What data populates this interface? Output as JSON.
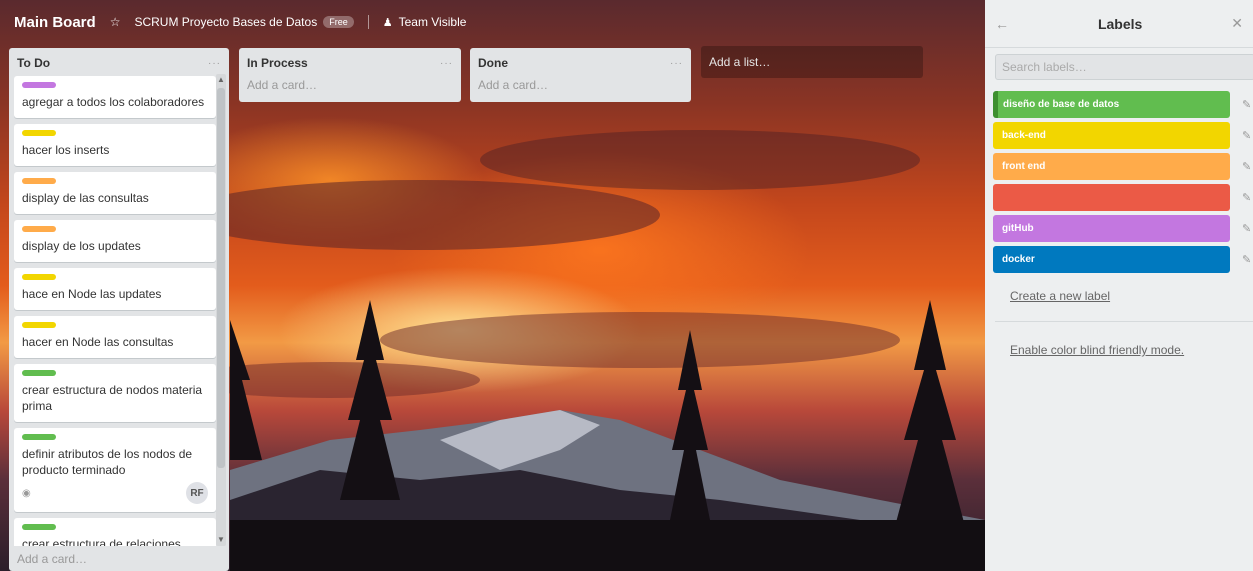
{
  "board": {
    "title": "Main Board",
    "star_icon": "star-icon",
    "project": "SCRUM Proyecto Bases de Datos",
    "plan_badge": "Free",
    "visibility": "Team Visible",
    "visibility_icon": "team-icon"
  },
  "lists": {
    "todo": {
      "title": "To Do",
      "add_card": "Add a card…",
      "cards": [
        {
          "title": "agregar a todos los colaboradores",
          "label_color": "#c377e0"
        },
        {
          "title": "hacer los inserts",
          "label_color": "#f2d600"
        },
        {
          "title": "display de las consultas",
          "label_color": "#ffab4a"
        },
        {
          "title": "display de los updates",
          "label_color": "#ffab4a"
        },
        {
          "title": "hace en Node las updates",
          "label_color": "#f2d600"
        },
        {
          "title": "hacer en Node las consultas",
          "label_color": "#f2d600"
        },
        {
          "title": "crear estructura de nodos materia prima",
          "label_color": "#61bd4f"
        },
        {
          "title": "definir atributos de los nodos de producto terminado",
          "label_color": "#61bd4f",
          "watch_icon": "eye-icon",
          "member": "RF"
        },
        {
          "title": "crear estructura de relaciones receta-materia-prima",
          "label_color": "#61bd4f"
        }
      ]
    },
    "inprocess": {
      "title": "In Process",
      "add_card": "Add a card…"
    },
    "done": {
      "title": "Done",
      "add_card": "Add a card…"
    }
  },
  "add_list": "Add a list…",
  "panel": {
    "title": "Labels",
    "search_placeholder": "Search labels…",
    "labels": [
      {
        "name": "diseño de base de datos",
        "color": "#61bd4f"
      },
      {
        "name": "back-end",
        "color": "#f2d600"
      },
      {
        "name": "front end",
        "color": "#ffab4a"
      },
      {
        "name": "",
        "color": "#eb5a46"
      },
      {
        "name": "gitHub",
        "color": "#c377e0"
      },
      {
        "name": "docker",
        "color": "#0079bf"
      }
    ],
    "create_label": "Create a new label",
    "colorblind": "Enable color blind friendly mode."
  }
}
